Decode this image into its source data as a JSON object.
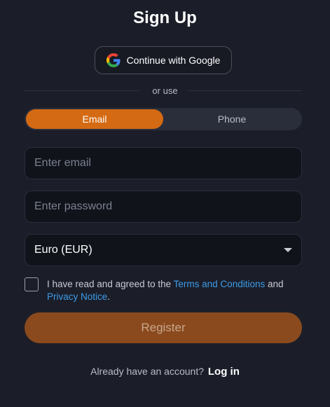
{
  "page": {
    "title": "Sign Up"
  },
  "google": {
    "label": "Continue with Google",
    "icon": "google-logo"
  },
  "divider": {
    "text": "or use"
  },
  "tabs": [
    {
      "label": "Email",
      "active": true
    },
    {
      "label": "Phone",
      "active": false
    }
  ],
  "form": {
    "email_placeholder": "Enter email",
    "email_value": "",
    "password_placeholder": "Enter password",
    "password_value": "",
    "currency_selected": "Euro (EUR)",
    "agree_checked": false,
    "agree_text_before": "I have read and agreed to the ",
    "terms_link": "Terms and Conditions",
    "agree_text_middle": " and ",
    "privacy_link": "Privacy Notice",
    "agree_text_after": "."
  },
  "register": {
    "label": "Register"
  },
  "footer": {
    "prompt": "Already have an account?",
    "login_link": "Log in"
  },
  "colors": {
    "background": "#1b1e29",
    "accent": "#d46a13",
    "register_disabled": "#8a4a1d",
    "link": "#3d9be9"
  }
}
